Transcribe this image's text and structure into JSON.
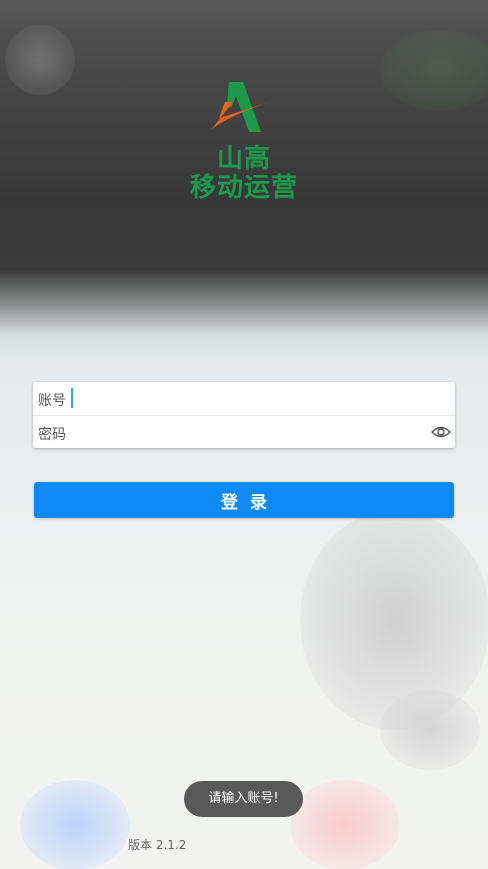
{
  "app": {
    "title_line1": "山高",
    "title_line2": "移动运营",
    "logo_icon": "a-letter-swoosh-logo",
    "brand_green": "#1b9a4b",
    "brand_orange": "#e8611a"
  },
  "form": {
    "account_label": "账号",
    "account_value": "",
    "password_label": "密码",
    "password_value": "",
    "password_toggle_icon": "eye-icon"
  },
  "login": {
    "label": "登录",
    "color": "#0d8af7"
  },
  "toast": {
    "message": "请输入账号!"
  },
  "footer": {
    "version": "版本 2.1.2"
  }
}
